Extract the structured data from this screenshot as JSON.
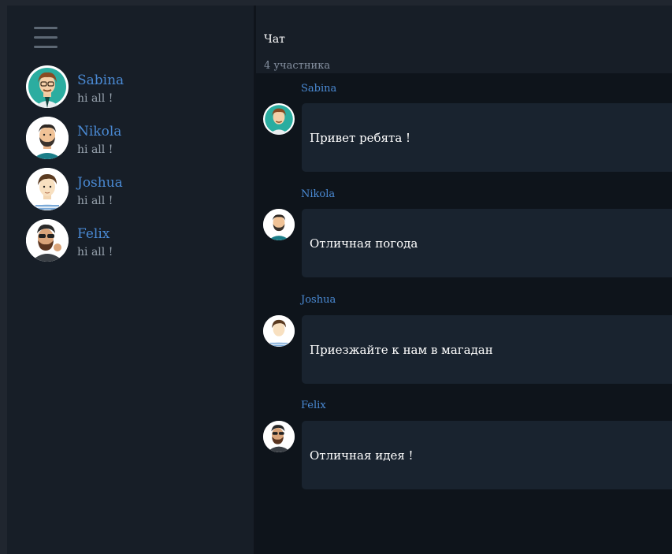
{
  "sidebar": {
    "contacts": [
      {
        "name": "Sabina",
        "last_message": "hi all !",
        "avatar": "avatar-sabina-icon"
      },
      {
        "name": "Nikola",
        "last_message": "hi all !",
        "avatar": "avatar-nikola-icon"
      },
      {
        "name": "Joshua",
        "last_message": "hi all !",
        "avatar": "avatar-joshua-icon"
      },
      {
        "name": "Felix",
        "last_message": "hi all !",
        "avatar": "avatar-felix-icon"
      }
    ]
  },
  "chat": {
    "title": "Чат",
    "participants": "4 участника",
    "messages": [
      {
        "author": "Sabina",
        "text": "Привет ребята !"
      },
      {
        "author": "Nikola",
        "text": "Отличная погода"
      },
      {
        "author": "Joshua",
        "text": "Приезжайте к нам в магадан"
      },
      {
        "author": "Felix",
        "text": "Отличная идея !"
      }
    ]
  },
  "colors": {
    "accent": "#4a8ad4",
    "sidebar_bg": "#171e27",
    "chat_bg": "#0e141b",
    "bubble_bg": "#19232f"
  }
}
